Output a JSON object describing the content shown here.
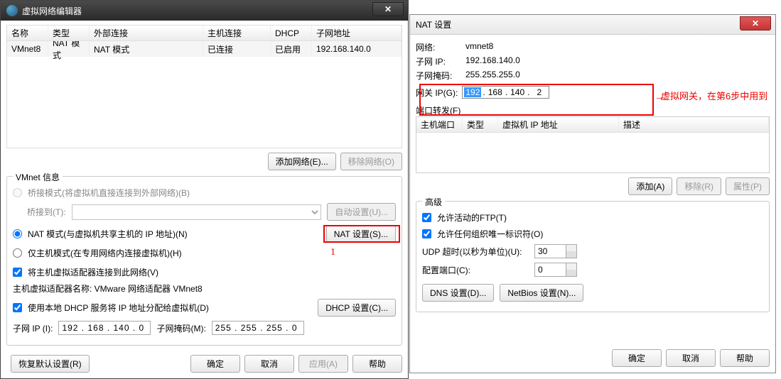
{
  "left": {
    "title": "虚拟网络编辑器",
    "columns": {
      "name": "名称",
      "type": "类型",
      "ext": "外部连接",
      "host": "主机连接",
      "dhcp": "DHCP",
      "subnet": "子网地址"
    },
    "row": {
      "name": "VMnet8",
      "type": "NAT 模式",
      "ext": "NAT 模式",
      "host": "已连接",
      "dhcp": "已启用",
      "subnet": "192.168.140.0"
    },
    "addNetwork": "添加网络(E)...",
    "removeNetwork": "移除网络(O)",
    "vmnetInfo": "VMnet 信息",
    "bridged": "桥接模式(将虚拟机直接连接到外部网络)(B)",
    "bridgedTo": "桥接到(T):",
    "autoSet": "自动设置(U)...",
    "nat": "NAT 模式(与虚拟机共享主机的 IP 地址)(N)",
    "natSettings": "NAT 设置(S)...",
    "hostOnly": "仅主机模式(在专用网络内连接虚拟机)(H)",
    "connectAdapter": "将主机虚拟适配器连接到此网络(V)",
    "adapterName": "主机虚拟适配器名称: VMware 网络适配器 VMnet8",
    "useDhcp": "使用本地 DHCP 服务将 IP 地址分配给虚拟机(D)",
    "dhcpSettings": "DHCP 设置(C)...",
    "subnetIp": "子网 IP (I):",
    "subnetIpVal": "192 . 168 . 140 .  0",
    "subnetMask": "子网掩码(M):",
    "subnetMaskVal": "255 . 255 . 255 .  0",
    "restore": "恢复默认设置(R)",
    "ok": "确定",
    "cancel": "取消",
    "apply": "应用(A)",
    "help": "帮助"
  },
  "right": {
    "title": "NAT 设置",
    "networkLabel": "网络:",
    "networkVal": "vmnet8",
    "subnetIpLabel": "子网 IP:",
    "subnetIpVal": "192.168.140.0",
    "subnetMaskLabel": "子网掩码:",
    "subnetMaskVal": "255.255.255.0",
    "gatewayLabel": "网关 IP(G):",
    "gatewayOct1": "192",
    "gatewayOct2": "168",
    "gatewayOct3": "140",
    "gatewayOct4": "2",
    "portForward": "端口转发(F)",
    "pfCols": {
      "port": "主机端口",
      "type": "类型",
      "vmip": "虚拟机 IP 地址",
      "desc": "描述"
    },
    "add": "添加(A)",
    "remove": "移除(R)",
    "props": "属性(P)",
    "advanced": "高级",
    "allowFtp": "允许活动的FTP(T)",
    "allowOrg": "允许任何组织唯一标识符(O)",
    "udpTimeout": "UDP 超时(以秒为单位)(U):",
    "udpVal": "30",
    "configPort": "配置端口(C):",
    "configVal": "0",
    "dnsSettings": "DNS 设置(D)...",
    "netbiosSettings": "NetBios 设置(N)...",
    "ok": "确定",
    "cancel": "取消",
    "help": "帮助"
  },
  "annotation": {
    "marker1": "1",
    "text": "虚拟网关，在第6步中用到",
    "arrow": "→"
  }
}
